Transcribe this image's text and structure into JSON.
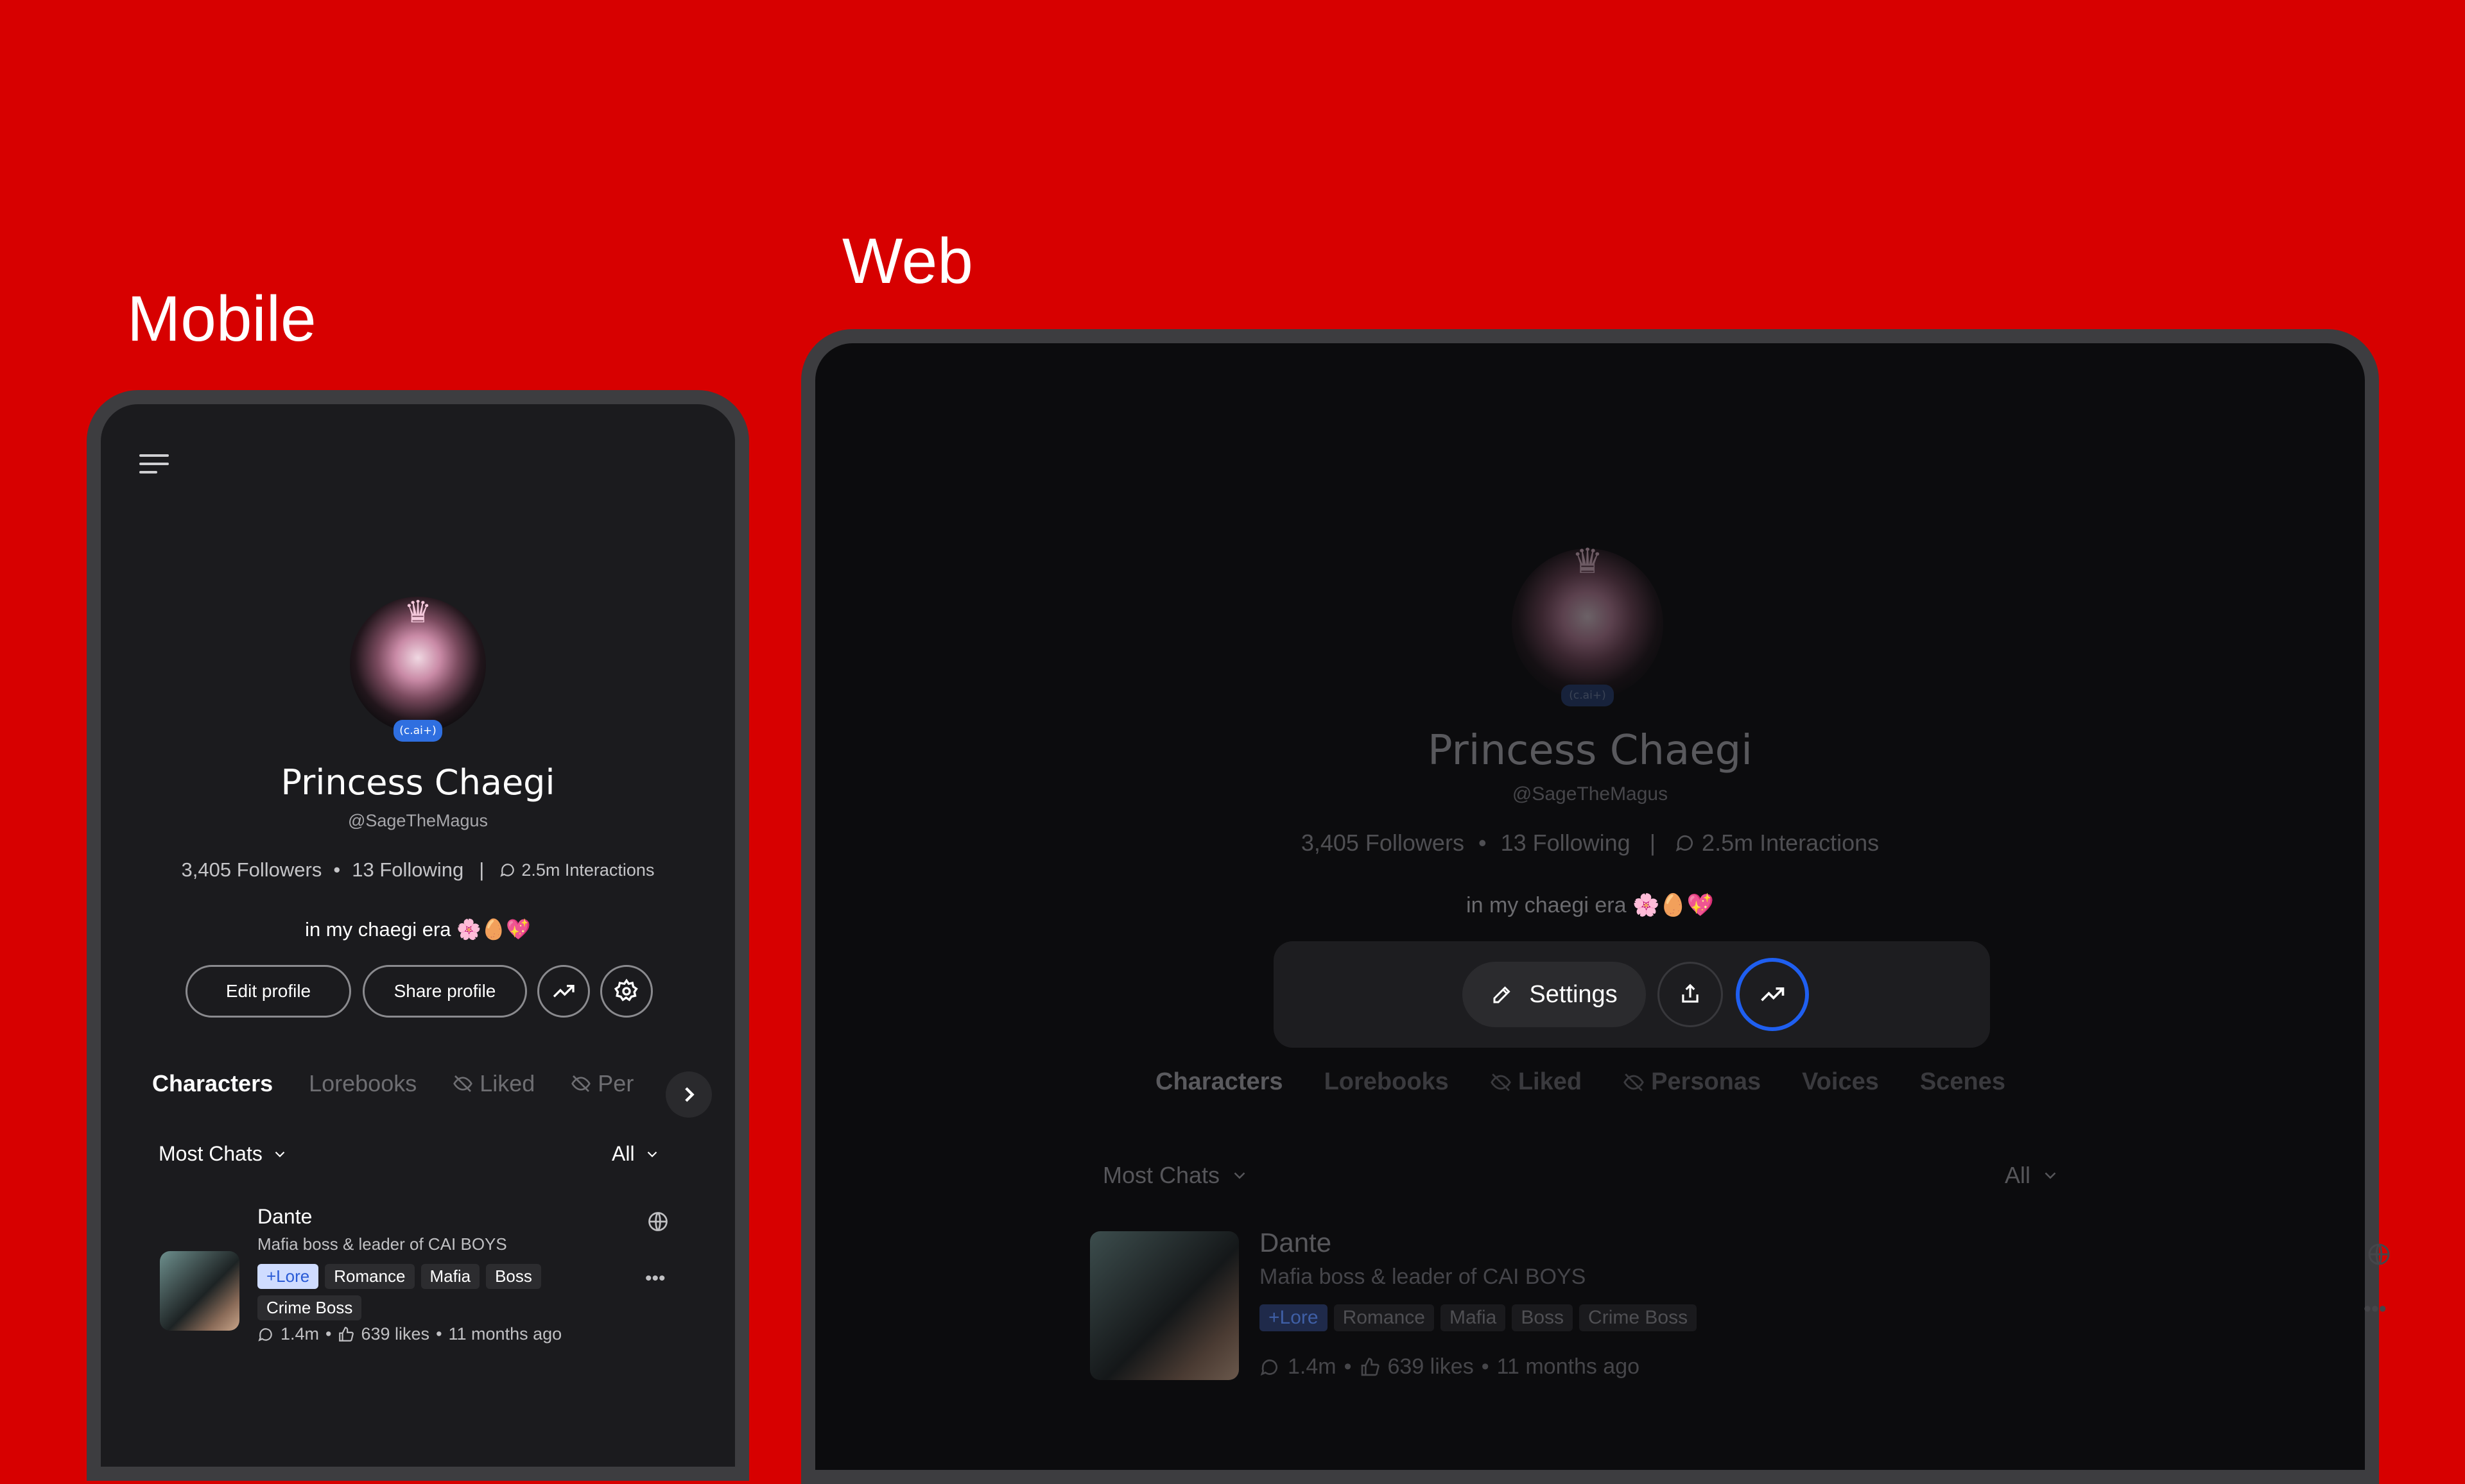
{
  "labels": {
    "mobile": "Mobile",
    "web": "Web"
  },
  "profile": {
    "badge": "(c.ai+)",
    "name": "Princess Chaegi",
    "handle": "@SageTheMagus",
    "followers": "3,405 Followers",
    "following": "13 Following",
    "interactions": "2.5m Interactions",
    "bio": "in my chaegi era 🌸🥚💖"
  },
  "mobile": {
    "buttons": {
      "edit": "Edit profile",
      "share": "Share profile"
    },
    "tabs": [
      "Characters",
      "Lorebooks",
      "Liked",
      "Per"
    ]
  },
  "web": {
    "settings_label": "Settings",
    "tabs": [
      "Characters",
      "Lorebooks",
      "Liked",
      "Personas",
      "Voices",
      "Scenes"
    ]
  },
  "sort": {
    "label": "Most Chats",
    "filter": "All"
  },
  "character": {
    "name": "Dante",
    "description": "Mafia boss & leader of CAI BOYS",
    "tags": [
      "+Lore",
      "Romance",
      "Mafia",
      "Boss",
      "Crime Boss"
    ],
    "chats": "1.4m",
    "likes": "639 likes",
    "age": "11 months ago"
  },
  "icons": {
    "menu": "menu-icon",
    "trend": "trending-up-icon",
    "gear": "gear-icon",
    "share": "share-icon",
    "pencil": "pencil-icon",
    "chat": "chat-bubble-icon",
    "like": "thumbs-up-icon",
    "globe": "globe-icon",
    "chevron": "chevron-down-icon",
    "hidden": "eye-off-icon",
    "more": "more-icon"
  },
  "colors": {
    "background": "#d70000",
    "accent": "#1f5ff0",
    "lore_tag": "#cfdcff"
  }
}
